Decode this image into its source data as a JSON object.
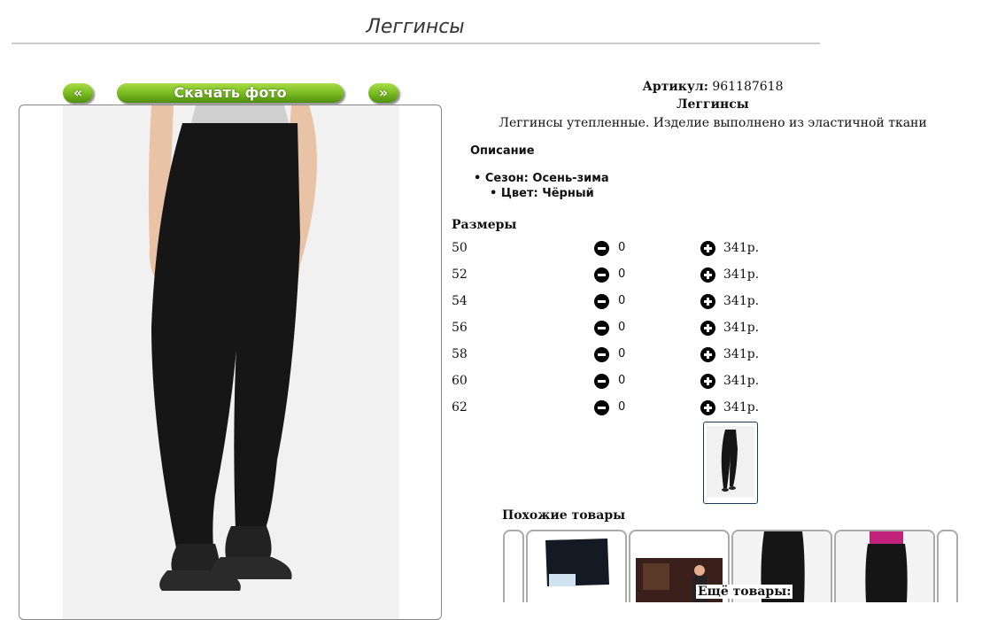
{
  "page": {
    "title": "Леггинсы"
  },
  "photo_nav": {
    "prev_label": "«",
    "download_label": "Скачать фото",
    "next_label": "»"
  },
  "product": {
    "article_label": "Артикул:",
    "article_value": "961187618",
    "name": "Леггинсы",
    "description": "Леггинсы утепленные. Изделие выполнено из эластичной ткани"
  },
  "details": {
    "heading": "Описание",
    "season": "Сезон: Осень-зима",
    "color": "Цвет: Чёрный"
  },
  "sizes": {
    "heading": "Размеры",
    "rows": [
      {
        "size": "50",
        "qty": "0",
        "price": "341р."
      },
      {
        "size": "52",
        "qty": "0",
        "price": "341р."
      },
      {
        "size": "54",
        "qty": "0",
        "price": "341р."
      },
      {
        "size": "56",
        "qty": "0",
        "price": "341р."
      },
      {
        "size": "58",
        "qty": "0",
        "price": "341р."
      },
      {
        "size": "60",
        "qty": "0",
        "price": "341р."
      },
      {
        "size": "62",
        "qty": "0",
        "price": "341р."
      }
    ]
  },
  "similar": {
    "heading": "Похожие товары"
  },
  "more": {
    "label": "Ещё товары:"
  },
  "colors": {
    "button_green": "#7bbd22",
    "frame_border": "#888888",
    "rule": "#cccccc"
  }
}
